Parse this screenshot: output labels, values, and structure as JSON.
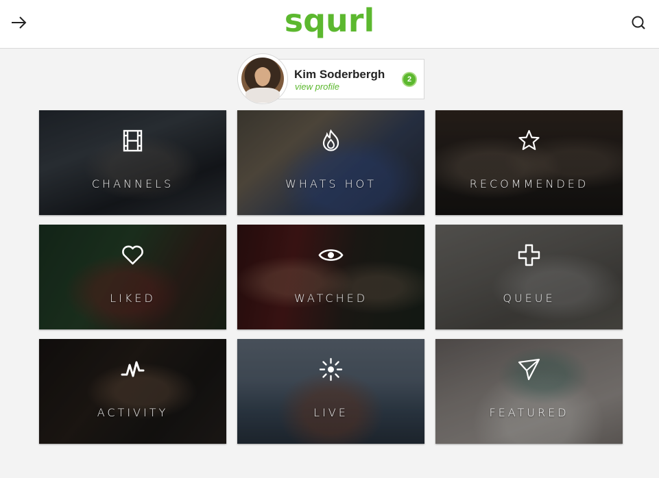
{
  "header": {
    "logo_text": "squrl",
    "back_icon": "arrow-right-icon",
    "search_icon": "search-icon",
    "accent_color": "#5cb82f"
  },
  "profile": {
    "name": "Kim Soderbergh",
    "link_text": "view profile",
    "badge_count": "2"
  },
  "tiles": [
    {
      "label": "CHANNELS",
      "icon": "film-strip-icon"
    },
    {
      "label": "WHATS HOT",
      "icon": "flame-icon"
    },
    {
      "label": "RECOMMENDED",
      "icon": "star-icon"
    },
    {
      "label": "LIKED",
      "icon": "heart-icon"
    },
    {
      "label": "WATCHED",
      "icon": "eye-icon"
    },
    {
      "label": "QUEUE",
      "icon": "plus-icon"
    },
    {
      "label": "ACTIVITY",
      "icon": "activity-pulse-icon"
    },
    {
      "label": "LIVE",
      "icon": "live-burst-icon"
    },
    {
      "label": "FEATURED",
      "icon": "paper-plane-icon"
    }
  ]
}
